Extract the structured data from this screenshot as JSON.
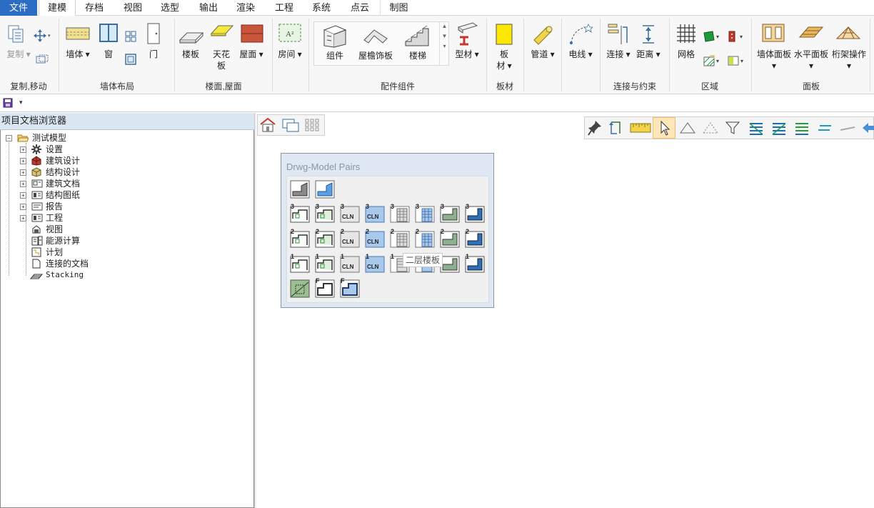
{
  "menu": {
    "file_label": "文件",
    "tabs": [
      "建模",
      "存档",
      "视图",
      "选型",
      "输出",
      "渲染",
      "工程",
      "系统",
      "点云",
      "制图"
    ],
    "active_tab": "建模"
  },
  "ribbon": {
    "copy_move": {
      "copy_label": "复制",
      "group": "复制,移动"
    },
    "wall_layout": {
      "wall": "墙体",
      "window": "窗",
      "door": "门",
      "group": "墙体布局"
    },
    "floor_roof": {
      "floor": "楼板",
      "ceiling": "天花\n板",
      "ceiling_l1": "天花",
      "ceiling_l2": "板",
      "roof": "屋面",
      "group": "楼面,屋面"
    },
    "room": {
      "room": "房间"
    },
    "components": {
      "component": "组件",
      "eave": "屋檐饰板",
      "stair": "楼梯",
      "profile": "型材",
      "group": "配件组件"
    },
    "board": {
      "board_l1": "板",
      "board_l2": "材",
      "group": "板材"
    },
    "pipe": {
      "pipe": "管道"
    },
    "wire": {
      "wire": "电线"
    },
    "connect": {
      "connect": "连接",
      "distance": "距离",
      "group": "连接与约束"
    },
    "zone": {
      "grid": "网格",
      "group": "区域"
    },
    "panel": {
      "wall_panel": "墙体面板",
      "horizontal_panel": "水平面板",
      "truss": "桁架操作",
      "group": "面板"
    }
  },
  "browser": {
    "title": "项目文档浏览器",
    "root": "测试模型",
    "items": [
      "设置",
      "建筑设计",
      "结构设计",
      "建筑文档",
      "结构图纸",
      "报告",
      "工程",
      "视图",
      "能源计算",
      "计划",
      "连接的文档",
      "Stacking"
    ]
  },
  "dialog": {
    "title": "Drwg-Model Pairs",
    "tooltip": "二层楼板",
    "row_labels": [
      "3",
      "2",
      "1"
    ],
    "cln": "CLN",
    "f_label": "F"
  },
  "colors": {
    "accent": "#2b6cc4",
    "panel_header": "#dbe6f3"
  }
}
